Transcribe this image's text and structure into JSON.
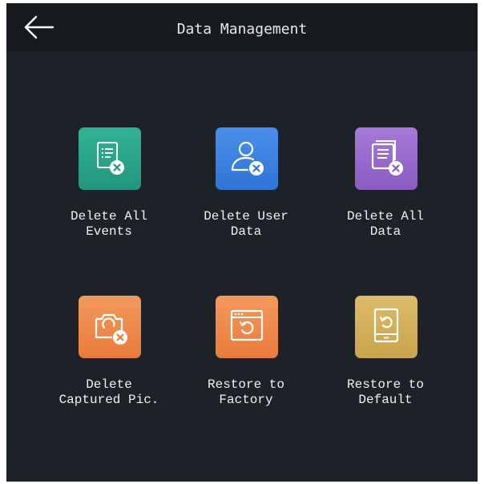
{
  "header": {
    "title": "Data Management",
    "back_icon": "arrow-left-icon"
  },
  "tiles": [
    {
      "label": "Delete All\nEvents",
      "icon": "event-list-delete-icon",
      "color": "#2aa58a"
    },
    {
      "label": "Delete User\nData",
      "icon": "user-delete-icon",
      "color": "#3b82e0"
    },
    {
      "label": "Delete All\nData",
      "icon": "document-delete-icon",
      "color": "#9a6cce"
    },
    {
      "label": "Delete\nCaptured Pic.",
      "icon": "camera-delete-icon",
      "color": "#ef8a4e"
    },
    {
      "label": "Restore to\nFactory",
      "icon": "window-restore-icon",
      "color": "#ef8a4e"
    },
    {
      "label": "Restore to\nDefault",
      "icon": "device-restore-icon",
      "color": "#d4b15c"
    }
  ]
}
